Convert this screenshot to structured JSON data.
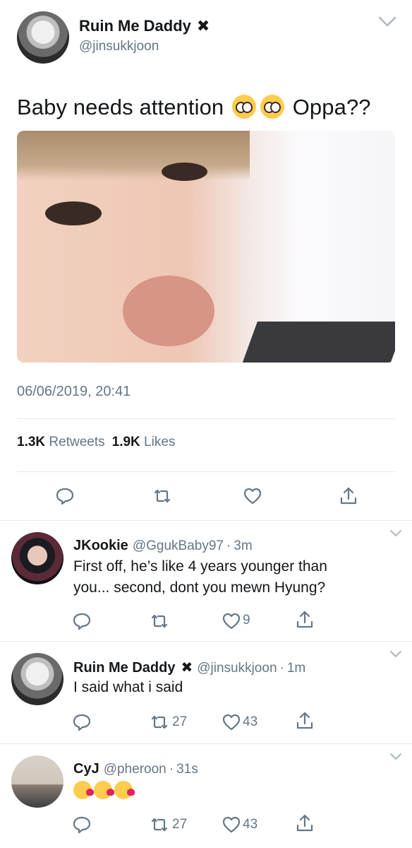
{
  "main_tweet": {
    "display_name": "Ruin Me Daddy",
    "name_symbol": "✖",
    "handle": "@jinsukkjoon",
    "text_before": "Baby needs attention",
    "text_after": "Oppa??",
    "text_emoji": "pleading-face",
    "timestamp": "06/06/2019, 20:41",
    "retweets_count": "1.3K",
    "retweets_label": "Retweets",
    "likes_count": "1.9K",
    "likes_label": "Likes",
    "actions": [
      "reply",
      "retweet",
      "like",
      "share"
    ]
  },
  "replies": [
    {
      "display_name": "JKookie",
      "handle": "@GgukBaby97",
      "separator": "·",
      "time": "3m",
      "text_line1": "First off, he’s like 4 years younger than",
      "text_line2": "you... second, dont you mewn Hyung?",
      "retweets": "",
      "likes": "9"
    },
    {
      "display_name": "Ruin Me Daddy",
      "name_symbol": "✖",
      "handle": "@jinsukkjoon",
      "separator": "·",
      "time": "1m",
      "text_line1": "I said what i said",
      "retweets": "27",
      "likes": "43"
    },
    {
      "display_name": "CyJ",
      "handle": "@pheroon",
      "separator": "·",
      "time": "31s",
      "text_emoji": "face-blowing-a-kiss ×3",
      "retweets": "27",
      "likes": "43"
    }
  ],
  "colors": {
    "text": "#14171a",
    "secondary": "#657786",
    "divider": "#e1e8ed",
    "emoji_yellow": "#ffcc4d"
  }
}
